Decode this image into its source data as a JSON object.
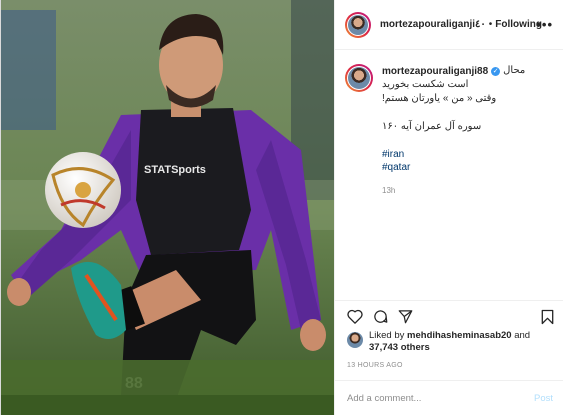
{
  "header": {
    "username": "mortezapouraliganji٤٠",
    "separator": "•",
    "follow_label": "Following",
    "more_icon": "more-dots-icon"
  },
  "caption": {
    "username": "mortezapouraliganji88",
    "verified_icon": "verified-badge-icon",
    "first_text": "محال",
    "lines": [
      "است شکست بخورید",
      "وقتی « من » یاورتان هستم!"
    ],
    "verse": "سوره آل عمران آیه ۱۶۰",
    "hashtags": [
      "#iran",
      "#qatar"
    ],
    "time": "13h"
  },
  "actions": {
    "icons": [
      "heart-icon",
      "comment-icon",
      "share-icon",
      "bookmark-icon"
    ]
  },
  "likes": {
    "prefix": "Liked by",
    "user": "mehdihasheminasab20",
    "connector": "and",
    "count": "37,743 others"
  },
  "post_date": "13 HOURS AGO",
  "comment": {
    "placeholder": "Add a comment...",
    "post_label": "Post"
  },
  "photo": {
    "shirt_print": "STATSports",
    "shorts_number": "88"
  },
  "colors": {
    "link": "#00376b",
    "verified": "#3897f0",
    "post_disabled": "#b2dffc",
    "muted": "#8e8e8e"
  }
}
